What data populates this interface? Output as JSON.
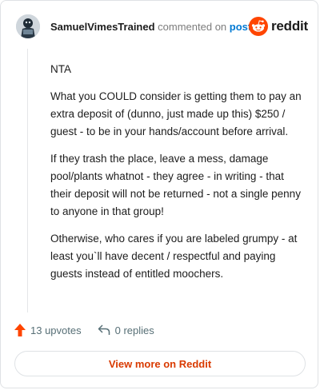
{
  "comment": {
    "username": "SamuelVimesTrained",
    "action_text": "commented on",
    "post_link_text": "post",
    "paragraphs": [
      "NTA",
      "What you COULD consider is getting them to pay an extra deposit of (dunno, just made up this) $250 / guest - to be in your hands/account before arrival.",
      "If they trash the place, leave a mess, damage pool/plants whatnot - they agree - in writing - that their deposit will not be returned - not a single penny to anyone in that group!",
      "Otherwise, who cares if you are labeled grumpy - at least you`ll have decent / respectful and paying guests instead of entitled moochers."
    ]
  },
  "brand": {
    "name": "reddit",
    "icon": "reddit-logo-icon",
    "color": "#ff4500"
  },
  "actions": {
    "upvotes": "13 upvotes",
    "replies": "0 replies",
    "upvote_icon": "upvote-arrow-icon",
    "reply_icon": "reply-arrow-icon",
    "upvote_color": "#ff4500"
  },
  "footer": {
    "view_more_label": "View more on Reddit",
    "label_color": "#d93a00"
  }
}
